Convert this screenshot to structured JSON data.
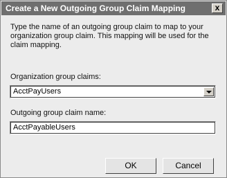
{
  "dialog": {
    "title": "Create a New Outgoing Group Claim Mapping",
    "close_label": "x",
    "description": "Type the name of an outgoing group claim to map to your organization group claim. This mapping will be used for the claim mapping.",
    "org_claims_label": "Organization group claims:",
    "org_claims_value": "AcctPayUsers",
    "outgoing_label": "Outgoing group claim name:",
    "outgoing_value": "AcctPayableUsers",
    "ok_label": "OK",
    "cancel_label": "Cancel"
  }
}
